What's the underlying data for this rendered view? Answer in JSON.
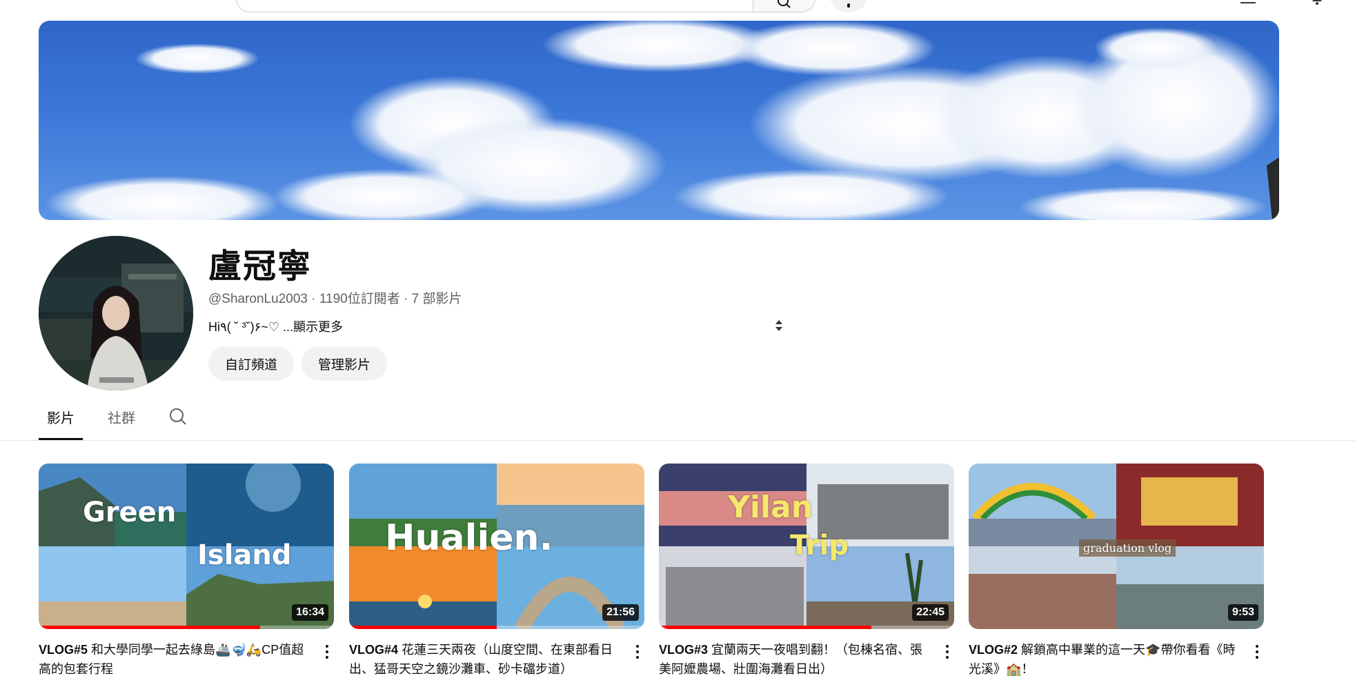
{
  "channel": {
    "name": "盧冠寧",
    "handle": "@SharonLu2003",
    "subscribers": "1190位訂閱者",
    "video_count": "7 部影片",
    "meta_separator": " · ",
    "description": "Hi٩( ˘ ³˘)۶~♡ ",
    "description_more": "...顯示更多",
    "buttons": {
      "customize": "自訂頻道",
      "manage": "管理影片"
    }
  },
  "tabs": [
    {
      "label": "影片",
      "active": true
    },
    {
      "label": "社群",
      "active": false
    }
  ],
  "videos": [
    {
      "title_tag": "VLOG#5",
      "title": " 和大學同學一起去綠島🚢🤿🛵CP值超高的包套行程",
      "duration": "16:34",
      "progress": 0.75,
      "overlay_words": [
        "Green",
        "Island"
      ]
    },
    {
      "title_tag": "VLOG#4",
      "title": " 花蓮三天兩夜（山度空間、在東部看日出、猛哥天空之鏡沙灘車、砂卡礑步道）",
      "duration": "21:56",
      "progress": 0.5,
      "overlay_words": [
        "Hualien."
      ]
    },
    {
      "title_tag": "VLOG#3",
      "title": " 宜蘭兩天一夜唱到翻！（包棟名宿、張美阿嬤農場、壯圍海灘看日出）",
      "duration": "22:45",
      "progress": 0.72,
      "overlay_words": [
        "Yilan",
        "Trip"
      ]
    },
    {
      "title_tag": "VLOG#2",
      "title": " 解鎖高中畢業的這一天🎓帶你看看《時光溪》🏫！",
      "duration": "9:53",
      "progress": 0.0,
      "overlay_words": [
        "graduation vlog"
      ]
    }
  ],
  "colors": {
    "accent_red": "#ff0000",
    "chip_bg": "#f2f2f2",
    "text_secondary": "#606060"
  },
  "icons": [
    "search-icon",
    "mic-icon",
    "sort-icon",
    "tab-search-icon",
    "more-vert-icon"
  ]
}
